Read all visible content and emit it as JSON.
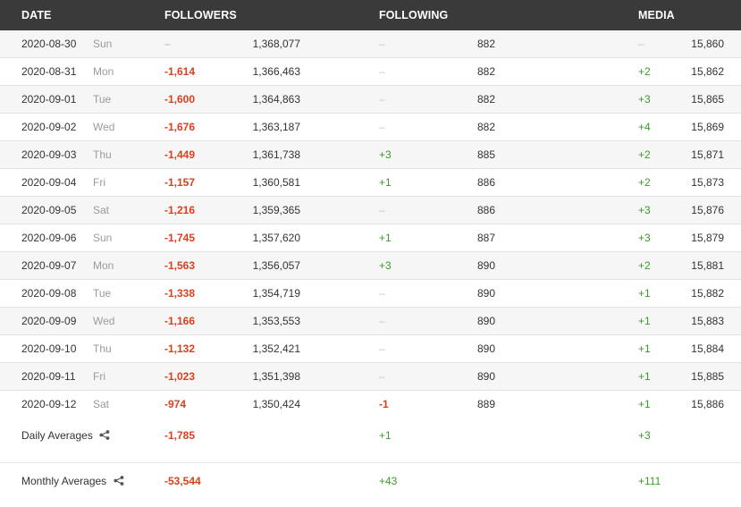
{
  "header": {
    "date": "DATE",
    "followers": "FOLLOWERS",
    "following": "FOLLOWING",
    "media": "MEDIA"
  },
  "rows": [
    {
      "date": "2020-08-30",
      "dow": "Sun",
      "followers_change": "–",
      "followers_total": "1,368,077",
      "following_change": "–",
      "following_total": "882",
      "media_change": "–",
      "media_total": "15,860"
    },
    {
      "date": "2020-08-31",
      "dow": "Mon",
      "followers_change": "-1,614",
      "followers_total": "1,366,463",
      "following_change": "–",
      "following_total": "882",
      "media_change": "+2",
      "media_total": "15,862"
    },
    {
      "date": "2020-09-01",
      "dow": "Tue",
      "followers_change": "-1,600",
      "followers_total": "1,364,863",
      "following_change": "–",
      "following_total": "882",
      "media_change": "+3",
      "media_total": "15,865"
    },
    {
      "date": "2020-09-02",
      "dow": "Wed",
      "followers_change": "-1,676",
      "followers_total": "1,363,187",
      "following_change": "–",
      "following_total": "882",
      "media_change": "+4",
      "media_total": "15,869"
    },
    {
      "date": "2020-09-03",
      "dow": "Thu",
      "followers_change": "-1,449",
      "followers_total": "1,361,738",
      "following_change": "+3",
      "following_total": "885",
      "media_change": "+2",
      "media_total": "15,871"
    },
    {
      "date": "2020-09-04",
      "dow": "Fri",
      "followers_change": "-1,157",
      "followers_total": "1,360,581",
      "following_change": "+1",
      "following_total": "886",
      "media_change": "+2",
      "media_total": "15,873"
    },
    {
      "date": "2020-09-05",
      "dow": "Sat",
      "followers_change": "-1,216",
      "followers_total": "1,359,365",
      "following_change": "–",
      "following_total": "886",
      "media_change": "+3",
      "media_total": "15,876"
    },
    {
      "date": "2020-09-06",
      "dow": "Sun",
      "followers_change": "-1,745",
      "followers_total": "1,357,620",
      "following_change": "+1",
      "following_total": "887",
      "media_change": "+3",
      "media_total": "15,879"
    },
    {
      "date": "2020-09-07",
      "dow": "Mon",
      "followers_change": "-1,563",
      "followers_total": "1,356,057",
      "following_change": "+3",
      "following_total": "890",
      "media_change": "+2",
      "media_total": "15,881"
    },
    {
      "date": "2020-09-08",
      "dow": "Tue",
      "followers_change": "-1,338",
      "followers_total": "1,354,719",
      "following_change": "–",
      "following_total": "890",
      "media_change": "+1",
      "media_total": "15,882"
    },
    {
      "date": "2020-09-09",
      "dow": "Wed",
      "followers_change": "-1,166",
      "followers_total": "1,353,553",
      "following_change": "–",
      "following_total": "890",
      "media_change": "+1",
      "media_total": "15,883"
    },
    {
      "date": "2020-09-10",
      "dow": "Thu",
      "followers_change": "-1,132",
      "followers_total": "1,352,421",
      "following_change": "–",
      "following_total": "890",
      "media_change": "+1",
      "media_total": "15,884"
    },
    {
      "date": "2020-09-11",
      "dow": "Fri",
      "followers_change": "-1,023",
      "followers_total": "1,351,398",
      "following_change": "–",
      "following_total": "890",
      "media_change": "+1",
      "media_total": "15,885"
    },
    {
      "date": "2020-09-12",
      "dow": "Sat",
      "followers_change": "-974",
      "followers_total": "1,350,424",
      "following_change": "-1",
      "following_total": "889",
      "media_change": "+1",
      "media_total": "15,886"
    }
  ],
  "averages": {
    "daily": {
      "label": "Daily Averages",
      "followers": "-1,785",
      "following": "+1",
      "media": "+3",
      "icon": "share-icon"
    },
    "monthly": {
      "label": "Monthly Averages",
      "followers": "-53,544",
      "following": "+43",
      "media": "+111",
      "icon": "share-icon"
    }
  },
  "colors": {
    "header_bg": "#3a3a3a",
    "negative": "#d9401e",
    "positive": "#3a9c2a",
    "neutral_dash": "#c4c4c4"
  }
}
